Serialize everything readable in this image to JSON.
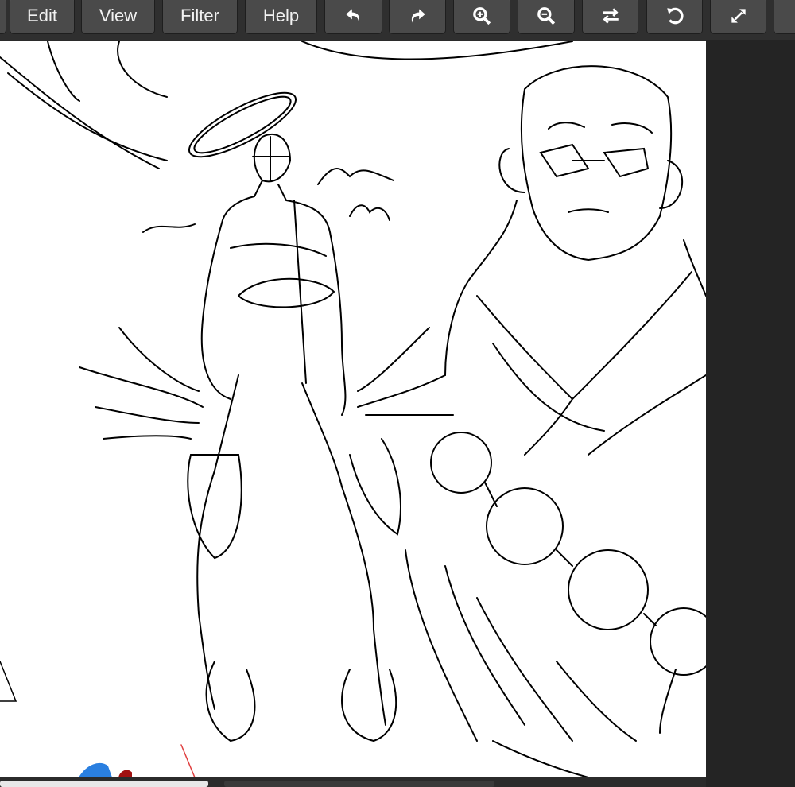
{
  "toolbar": {
    "menus": [
      {
        "label": "Edit"
      },
      {
        "label": "View"
      },
      {
        "label": "Filter"
      },
      {
        "label": "Help"
      }
    ],
    "tools": [
      {
        "icon": "undo-icon"
      },
      {
        "icon": "redo-icon"
      },
      {
        "icon": "zoom-in-icon"
      },
      {
        "icon": "zoom-out-icon"
      },
      {
        "icon": "flip-icon"
      },
      {
        "icon": "rotate-icon"
      },
      {
        "icon": "fullscreen-icon"
      }
    ]
  },
  "colors": {
    "toolbar_bg": "#2f2f2f",
    "button_bg": "#4a4a4a",
    "canvas_bg": "#ffffff",
    "panel_bg": "#242424"
  }
}
